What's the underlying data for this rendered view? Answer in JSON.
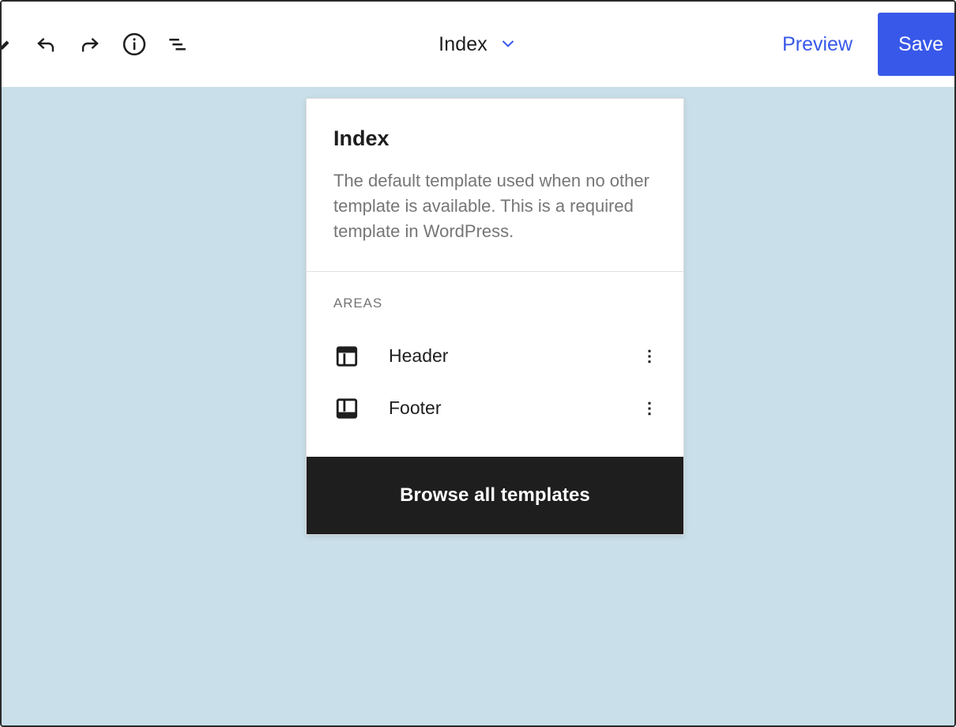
{
  "window": {
    "background_color": "#c9dfe9",
    "accent_color": "#3858e9",
    "dark_color": "#1e1e1e"
  },
  "header": {
    "site_logo": {
      "name": "site-logo-pencil",
      "label": "Edit site"
    },
    "tools": [
      {
        "name": "undo-icon",
        "label": "Undo"
      },
      {
        "name": "redo-icon",
        "label": "Redo"
      },
      {
        "name": "info-icon",
        "label": "Details"
      },
      {
        "name": "list-view-icon",
        "label": "List View"
      }
    ],
    "template_title": "Index",
    "template_title_chevron": "chevron-down-icon",
    "preview_label": "Preview",
    "save_label": "Save"
  },
  "template_panel": {
    "title": "Index",
    "description": "The default template used when no other template is available. This is a required template in WordPress.",
    "areas_heading": "AREAS",
    "areas": [
      {
        "label": "Header",
        "icon": "header-layout-icon",
        "menu_icon": "more-vertical-icon"
      },
      {
        "label": "Footer",
        "icon": "footer-layout-icon",
        "menu_icon": "more-vertical-icon"
      }
    ],
    "browse_all_label": "Browse all templates"
  }
}
